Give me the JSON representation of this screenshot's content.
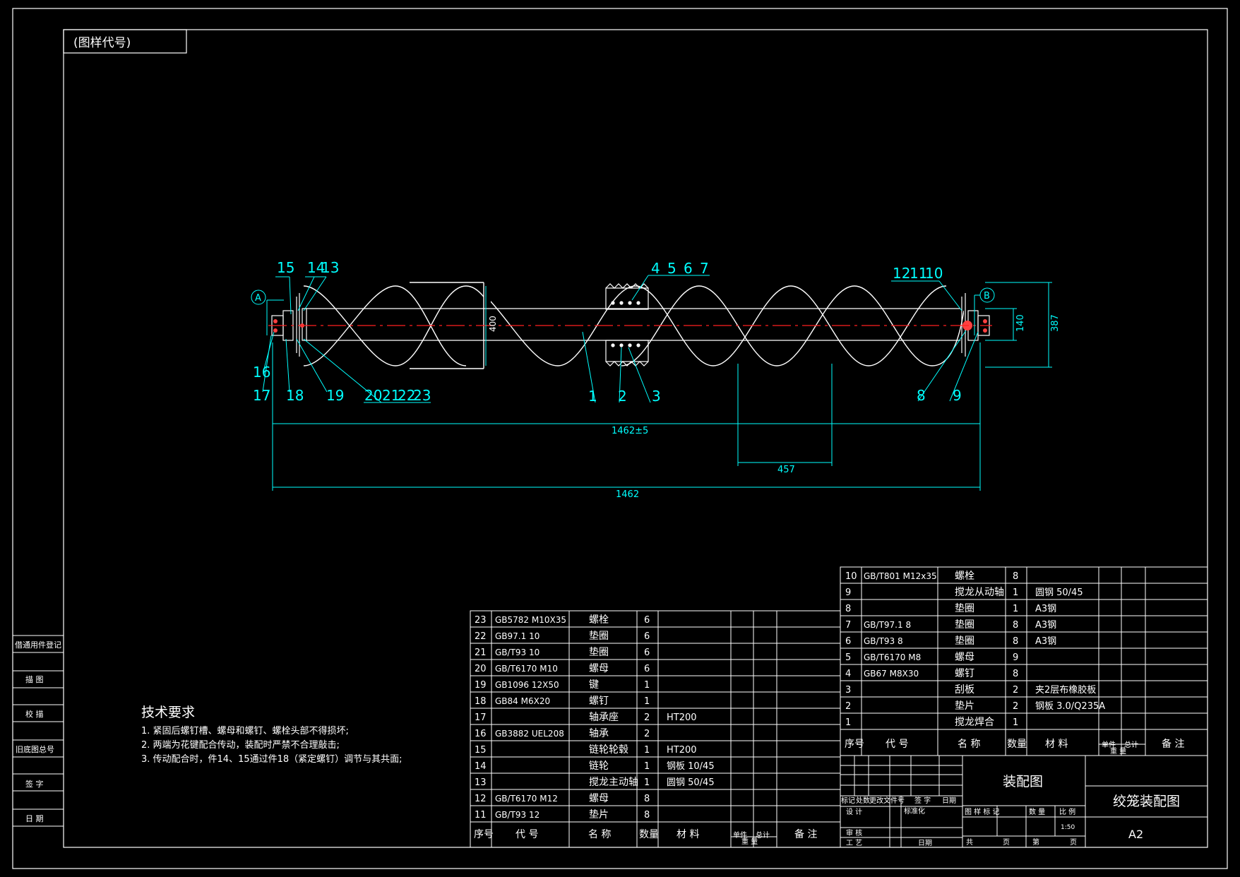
{
  "frame": {
    "corner_tag": "(图样代号)"
  },
  "side_column": [
    "借通用件登记",
    "描 图",
    "校 描",
    "旧底图总号",
    "签 字",
    "日 期"
  ],
  "balloons": [
    "15",
    "14",
    "13",
    "16",
    "17",
    "18",
    "19",
    "20",
    "21",
    "22",
    "23",
    "4",
    "5",
    "6",
    "7",
    "1",
    "2",
    "3",
    "12",
    "11",
    "10",
    "8",
    "9"
  ],
  "section_marks": {
    "a": "A",
    "b": "B"
  },
  "dimensions": {
    "overall_upper": "1462±5",
    "overall_lower": "1462",
    "pitch": "457",
    "flight_dia": "400",
    "height": "387",
    "shaft": "140"
  },
  "tech_requirements": {
    "title": "技术要求",
    "items": [
      "1. 紧固后螺钉槽、螺母和螺钉、螺栓头部不得损坏;",
      "2. 两端为花键配合传动，装配时严禁不合理敲击;",
      "3. 传动配合时，件14、15通过件18（紧定螺钉）调节与其共面;"
    ]
  },
  "bom_left": {
    "rows": [
      {
        "no": "23",
        "code": "GB5782 M10X35",
        "name": "螺栓",
        "qty": "6",
        "material": ""
      },
      {
        "no": "22",
        "code": "GB97.1 10",
        "name": "垫圈",
        "qty": "6",
        "material": ""
      },
      {
        "no": "21",
        "code": "GB/T93 10",
        "name": "垫圈",
        "qty": "6",
        "material": ""
      },
      {
        "no": "20",
        "code": "GB/T6170 M10",
        "name": "螺母",
        "qty": "6",
        "material": ""
      },
      {
        "no": "19",
        "code": "GB1096 12X50",
        "name": "键",
        "qty": "1",
        "material": ""
      },
      {
        "no": "18",
        "code": "GB84 M6X20",
        "name": "螺钉",
        "qty": "1",
        "material": ""
      },
      {
        "no": "17",
        "code": "",
        "name": "轴承座",
        "qty": "2",
        "material": "HT200"
      },
      {
        "no": "16",
        "code": "GB3882 UEL208",
        "name": "轴承",
        "qty": "2",
        "material": ""
      },
      {
        "no": "15",
        "code": "",
        "name": "链轮轮毂",
        "qty": "1",
        "material": "HT200"
      },
      {
        "no": "14",
        "code": "",
        "name": "链轮",
        "qty": "1",
        "material": "钢板 10/45"
      },
      {
        "no": "13",
        "code": "",
        "name": "搅龙主动轴",
        "qty": "1",
        "material": "圆钢 50/45"
      },
      {
        "no": "12",
        "code": "GB/T6170 M12",
        "name": "螺母",
        "qty": "8",
        "material": ""
      },
      {
        "no": "11",
        "code": "GB/T93 12",
        "name": "垫片",
        "qty": "8",
        "material": ""
      }
    ],
    "header": [
      "序号",
      "代 号",
      "名 称",
      "数量",
      "材 料",
      "单件",
      "总计",
      "重 量",
      "备 注"
    ]
  },
  "bom_right": {
    "rows": [
      {
        "no": "10",
        "code": "GB/T801 M12x35",
        "name": "螺栓",
        "qty": "8",
        "material": ""
      },
      {
        "no": "9",
        "code": "",
        "name": "搅龙从动轴",
        "qty": "1",
        "material": "圆钢 50/45"
      },
      {
        "no": "8",
        "code": "",
        "name": "垫圈",
        "qty": "1",
        "material": "A3钢"
      },
      {
        "no": "7",
        "code": "GB/T97.1 8",
        "name": "垫圈",
        "qty": "8",
        "material": "A3钢"
      },
      {
        "no": "6",
        "code": "GB/T93 8",
        "name": "垫圈",
        "qty": "8",
        "material": "A3钢"
      },
      {
        "no": "5",
        "code": "GB/T6170 M8",
        "name": "螺母",
        "qty": "9",
        "material": ""
      },
      {
        "no": "4",
        "code": "GB67 M8X30",
        "name": "螺钉",
        "qty": "8",
        "material": ""
      },
      {
        "no": "3",
        "code": "",
        "name": "刮板",
        "qty": "2",
        "material": "夹2层布橡胶板"
      },
      {
        "no": "2",
        "code": "",
        "name": "垫片",
        "qty": "2",
        "material": "钢板 3.0/Q235A"
      },
      {
        "no": "1",
        "code": "",
        "name": "搅龙焊合",
        "qty": "1",
        "material": ""
      }
    ],
    "header": [
      "序号",
      "代 号",
      "名 称",
      "数量",
      "材 料",
      "单件",
      "总计",
      "重 量",
      "备 注"
    ]
  },
  "title_block": {
    "rev_header": [
      "标记",
      "处数",
      "更改文件号",
      "签 字",
      "日期"
    ],
    "design": "设 计",
    "standard": "标准化",
    "review": "审 核",
    "process": "工 艺",
    "date": "日期",
    "drawing_type": "装配图",
    "drawing_name": "绞笼装配图",
    "stage": "图 样 标 记",
    "qty": "数 量",
    "scale_label": "比 例",
    "scale": "1:50",
    "sheet_total": "共",
    "sheet_page": "页",
    "sheet_no": "第",
    "sheet_page2": "页",
    "format": "A2"
  }
}
